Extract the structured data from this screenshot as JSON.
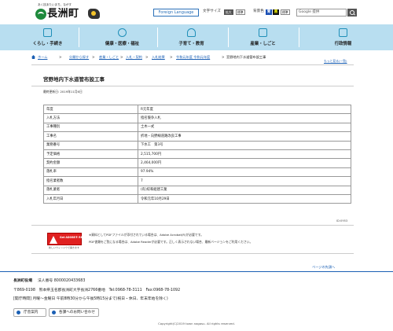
{
  "header": {
    "tagline": "あく技あたいまち、ながす",
    "logo_text": "長洲町",
    "lang_button": "Foreign Language",
    "font_size_label": "文字サイズ",
    "font_enlarge": "拡大",
    "font_standard": "標準",
    "bg_color_label": "背景色",
    "bg_blue": "青",
    "bg_black": "黒",
    "bg_standard": "標準",
    "search_placeholder": "Google 提供"
  },
  "nav": [
    {
      "label": "くらし・手続き"
    },
    {
      "label": "健康・医療・福祉"
    },
    {
      "label": "子育て・教育"
    },
    {
      "label": "産業・しごと"
    },
    {
      "label": "行政情報"
    }
  ],
  "breadcrumb": {
    "home": "ホーム",
    "items": [
      "分類から探す",
      "産業・しごと",
      "入札・契約",
      "入札結果",
      "令和元年度 令和元年度",
      "宮野地内下水道管布設工事"
    ],
    "back_link": "もっと見る(一覧)"
  },
  "page": {
    "title": "宮野地内下水道管布設工事",
    "updated": "最終更新日: 2019年11月6日"
  },
  "table": {
    "rows": [
      {
        "key": "年度",
        "value": "R元年度"
      },
      {
        "key": "入札方法",
        "value": "指名競争入札"
      },
      {
        "key": "工事種別",
        "value": "土木一式"
      },
      {
        "key": "工事名",
        "value": "折地・向野線道路改良工事"
      },
      {
        "key": "業務番号",
        "value": "下水工　第3号"
      },
      {
        "key": "予定価格",
        "value": "2,515,700円"
      },
      {
        "key": "契約金額",
        "value": "2,464,000円"
      },
      {
        "key": "落札率",
        "value": "97.94%"
      },
      {
        "key": "指名業者数",
        "value": "7"
      },
      {
        "key": "落札業者",
        "value": "(有)綜和組建工業"
      },
      {
        "key": "入札年月日",
        "value": "令和元年10月29日"
      }
    ]
  },
  "id_code": "ID:0953",
  "pdf": {
    "badge": "Get ADOBE® READER®",
    "caption": "新しいウィンドウで開きます",
    "note_1": "※資料としてPDFファイルが添付されている場合は、Adobe Acrobat(R)が必要です。",
    "note_2": "PDF書類をご覧になる場合は、Adobe Readerが必要です。正しく表示されない場合、最新バージョンをご利用ください。"
  },
  "page_top": "ページの先頭へ",
  "footer": {
    "office": "長洲町役場",
    "corp_number": "法人番号 8000020433683",
    "address": "〒869-0198　熊本県玉名郡長洲町大字長洲2766番地　Tel:0968-78-3111　Fax:0968-78-1092",
    "hours": "[開庁時間] 月曜～金曜日 午前8時30分から午後5時15分まで(祝日・休日、年末年始を除く)",
    "btn_guide": "庁舎案内",
    "btn_contact": "各課へのお問い合わせ",
    "copyright": "Copyright(C)2019 town nagasu. All rights reserved."
  }
}
